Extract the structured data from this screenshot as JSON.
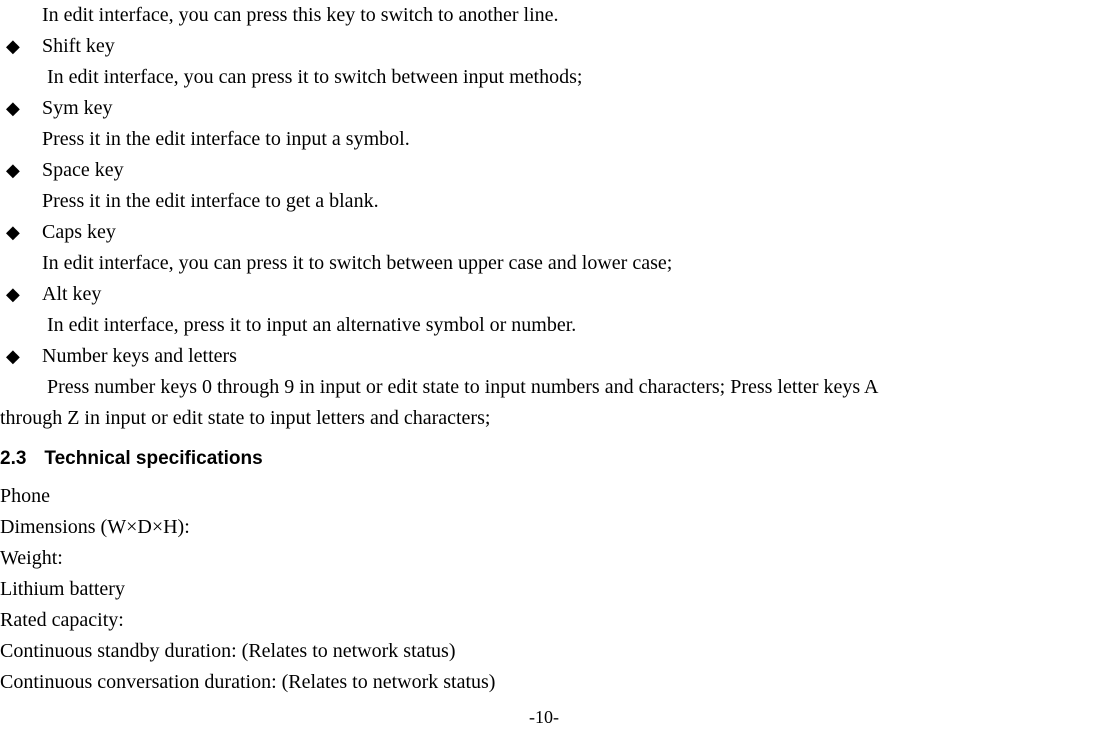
{
  "intro_line": "In edit interface, you can press this key to switch to another line.",
  "items": [
    {
      "title": "Shift key",
      "desc": " In edit interface, you can press it to switch between input methods;",
      "desc_indent": "space"
    },
    {
      "title": "Sym key",
      "desc": "Press it in the edit interface to input a symbol.",
      "desc_indent": "normal"
    },
    {
      "title": "Space key",
      "desc": "Press it in the edit interface to get a blank.",
      "desc_indent": "normal"
    },
    {
      "title": "Caps key",
      "desc": "In edit interface, you can press it to switch between upper case and lower case;",
      "desc_indent": "normal"
    },
    {
      "title": "Alt key",
      "desc": " In edit interface, press it to input an alternative symbol or number.",
      "desc_indent": "space"
    },
    {
      "title": "Number keys and letters",
      "desc": " Press number keys 0 through 9 in input or edit state to input numbers and characters; Press letter keys A",
      "desc_indent": "space"
    }
  ],
  "continuation": "through Z in input or edit state to input letters and characters;",
  "section": {
    "num": "2.3",
    "title": "Technical specifications"
  },
  "specs": [
    "Phone",
    "Dimensions (W×D×H):",
    "Weight:",
    "Lithium battery",
    "Rated capacity:",
    "Continuous standby duration: (Relates to network status)",
    "Continuous conversation duration: (Relates to network status)"
  ],
  "page_number": "-10-"
}
